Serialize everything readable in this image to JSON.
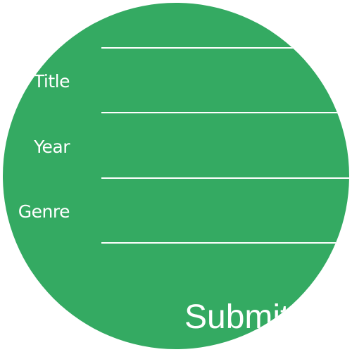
{
  "form": {
    "fields": [
      {
        "label": "Title",
        "value": "",
        "placeholder": ""
      },
      {
        "label": "Year",
        "value": "",
        "placeholder": ""
      },
      {
        "label": "Genre",
        "value": "",
        "placeholder": ""
      }
    ],
    "submit_label": "Submit"
  },
  "colors": {
    "background": "#ffffff",
    "accent": "#34aa62",
    "text": "#ffffff"
  }
}
